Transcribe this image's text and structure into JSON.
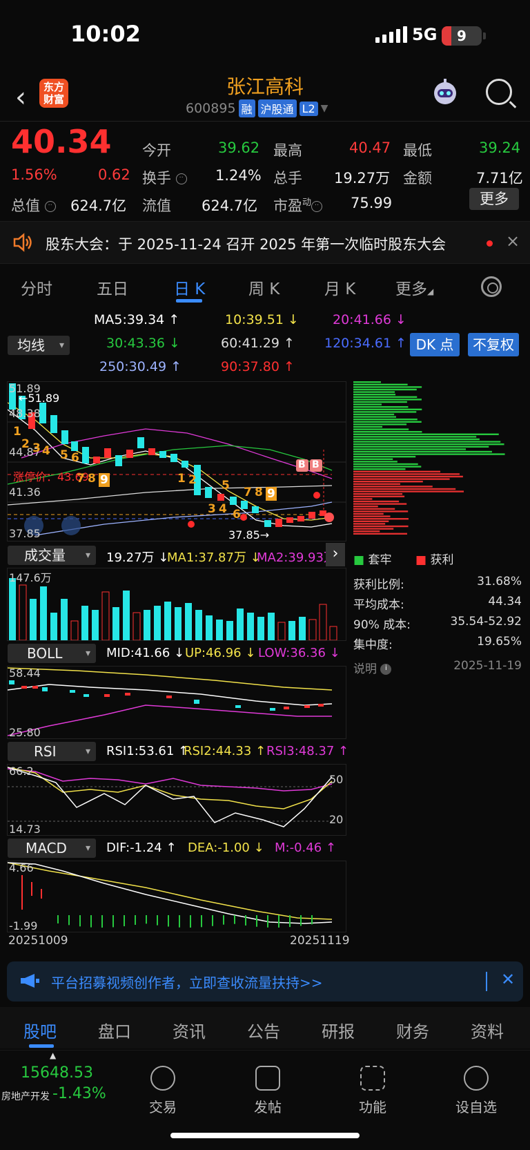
{
  "status_bar": {
    "time": "10:02",
    "network": "5G",
    "battery": "9"
  },
  "header": {
    "title": "张江高科",
    "code": "600895",
    "tags": [
      "融",
      "沪股通",
      "L2"
    ],
    "logo_text": "东方财富"
  },
  "quote": {
    "price": "40.34",
    "change_pct": "1.56%",
    "change": "0.62",
    "open_label": "今开",
    "open": "39.62",
    "high_label": "最高",
    "high": "40.47",
    "low_label": "最低",
    "low": "39.24",
    "turnover_label": "换手",
    "turnover": "1.24%",
    "volume_label": "总手",
    "volume": "19.27万",
    "amount_label": "金额",
    "amount": "7.71亿",
    "mktcap_label": "总值",
    "mktcap": "624.7亿",
    "float_label": "流值",
    "float": "624.7亿",
    "pe_label": "市盈",
    "pe_sup": "动",
    "pe": "75.99",
    "more_label": "更多"
  },
  "notice": {
    "text": "股东大会：于 2025-11-24 召开 2025 年第一次临时股东大会",
    "close": "×"
  },
  "tabs": [
    "分时",
    "五日",
    "日 K",
    "周 K",
    "月 K",
    "更多"
  ],
  "active_tab": "日 K",
  "ma": {
    "selector": "均线",
    "ma5": "MA5:39.34 ↑",
    "ma10": "10:39.51 ↓",
    "ma20": "20:41.66 ↓",
    "ma30": "30:43.36 ↓",
    "ma60": "60:41.29 ↑",
    "ma120": "120:34.61 ↑",
    "ma250": "250:30.49 ↑",
    "ma90": "90:37.80 ↑",
    "dk_btn": "DK 点",
    "fq_btn": "不复权"
  },
  "kline": {
    "y_labels": [
      "51.89",
      "48.38",
      "44.87",
      "41.36",
      "37.85"
    ],
    "high_marker": "←51.89",
    "low_marker": "37.85→",
    "limit_label": "涨停价：43.69",
    "b_marks": [
      "B",
      "B"
    ],
    "counts_a": [
      "1",
      "2",
      "3",
      "4",
      "5",
      "6",
      "7",
      "8",
      "9"
    ],
    "counts_b": [
      "1",
      "2",
      "3",
      "4",
      "5",
      "6",
      "7",
      "8",
      "9"
    ],
    "counts_c": [
      "7",
      "8",
      "9"
    ]
  },
  "volume": {
    "selector": "成交量",
    "value": "19.27万 ↓",
    "ma1": "MA1:37.87万 ↓",
    "ma2": "MA2:39.93万",
    "y_top": "147.6万"
  },
  "boll": {
    "selector": "BOLL",
    "mid": "MID:41.66 ↓",
    "up": "UP:46.96 ↓",
    "low": "LOW:36.36 ↓",
    "y_top": "58.44",
    "y_bot": "25.80"
  },
  "rsi": {
    "selector": "RSI",
    "rsi1": "RSI1:53.61 ↑",
    "rsi2": "RSI2:44.33 ↑",
    "rsi3": "RSI3:48.37 ↑",
    "y_top": "66.2",
    "y_bot": "14.73",
    "l50": "50",
    "l20": "20"
  },
  "macd": {
    "selector": "MACD",
    "dif": "DIF:-1.24 ↑",
    "dea": "DEA:-1.00 ↓",
    "m": "M:-0.46 ↑",
    "y_top": "4.66",
    "y_bot": "-1.99"
  },
  "dates": {
    "start": "20251009",
    "end": "20251119"
  },
  "chips": {
    "legend_hold": "套牢",
    "legend_profit": "获利",
    "rows": [
      {
        "label": "获利比例:",
        "value": "31.68%"
      },
      {
        "label": "平均成本:",
        "value": "44.34"
      },
      {
        "label": "90% 成本:",
        "value": "35.54-52.92"
      },
      {
        "label": "集中度:",
        "value": "19.65%"
      }
    ],
    "note": "说明",
    "date": "2025-11-19"
  },
  "ad": {
    "text": "平台招募视频创作者，立即查收流量扶持>>",
    "close": "✕"
  },
  "bottom_tabs": [
    "股吧",
    "盘口",
    "资讯",
    "公告",
    "研报",
    "财务",
    "资料"
  ],
  "dock": {
    "index_value": "15648.53",
    "index_name": "房地产开发",
    "index_change": "-1.43%",
    "items": [
      "交易",
      "发帖",
      "功能",
      "设自选"
    ]
  },
  "colors": {
    "up": "#ff3030",
    "down": "#27c93f",
    "accent": "#3b8cff",
    "name": "#f0a020"
  }
}
